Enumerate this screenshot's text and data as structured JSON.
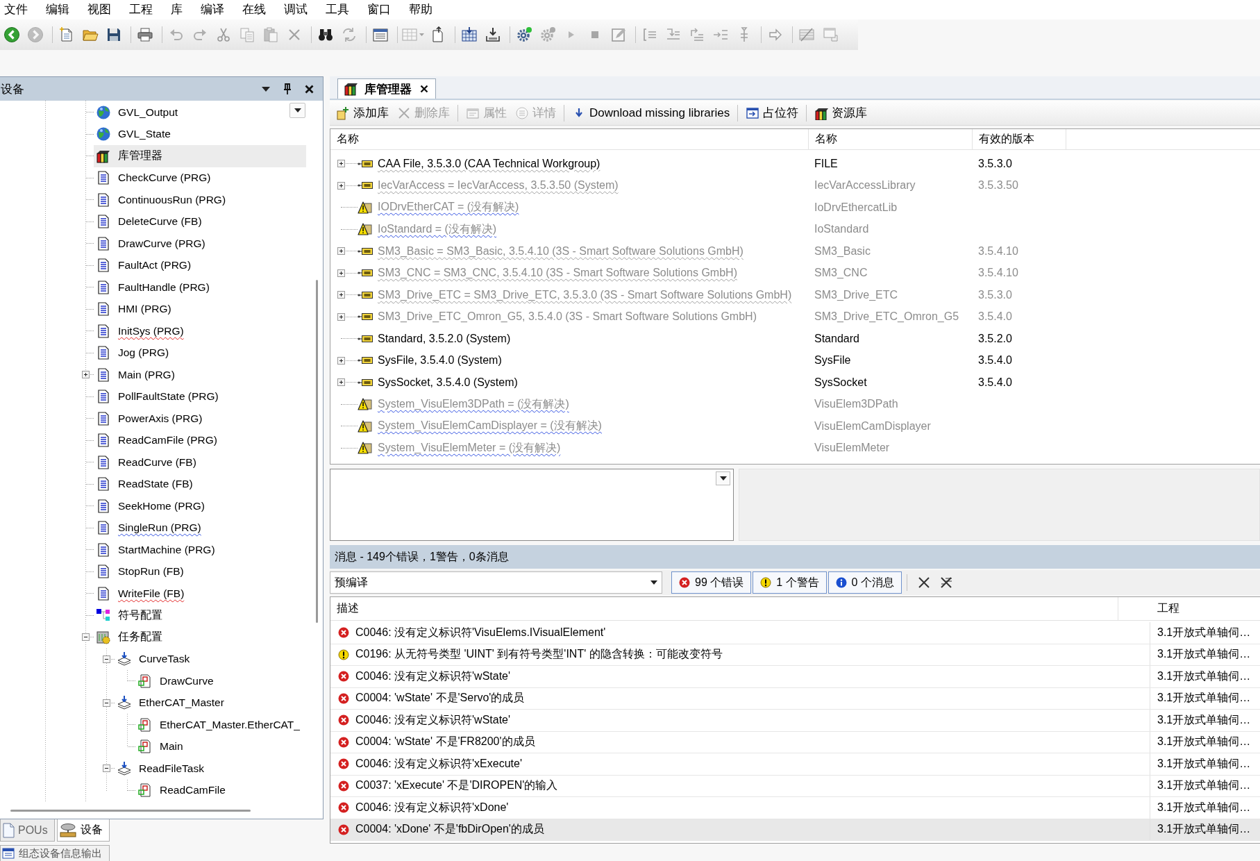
{
  "menu": [
    "文件",
    "编辑",
    "视图",
    "工程",
    "库",
    "编译",
    "在线",
    "调试",
    "工具",
    "窗口",
    "帮助"
  ],
  "toolbar": [
    [
      {
        "disabled": false
      },
      {
        "disabled": true
      }
    ],
    [
      {
        "disabled": false
      },
      {
        "disabled": false
      },
      {
        "disabled": false
      }
    ],
    [
      {
        "disabled": false
      }
    ],
    [
      {
        "disabled": true
      },
      {
        "disabled": true
      },
      {
        "disabled": true
      },
      {
        "disabled": true
      },
      {
        "disabled": true
      },
      {
        "disabled": true
      }
    ],
    [
      {
        "disabled": false
      },
      {
        "disabled": true
      }
    ],
    [
      {
        "disabled": false
      }
    ],
    [
      {
        "disabled": true
      },
      {
        "disabled": false
      }
    ],
    [
      {
        "disabled": false
      },
      {
        "disabled": false
      }
    ],
    [
      {
        "disabled": false
      },
      {
        "disabled": true
      },
      {
        "disabled": true
      },
      {
        "disabled": true
      },
      {
        "disabled": true
      }
    ],
    [
      {
        "disabled": true
      },
      {
        "disabled": true
      },
      {
        "disabled": true
      },
      {
        "disabled": true
      },
      {
        "disabled": true
      }
    ],
    [
      {
        "disabled": true
      }
    ],
    [
      {
        "disabled": true
      },
      {
        "disabled": true
      }
    ]
  ],
  "device_panel": {
    "title": "设备",
    "tree": [
      {
        "label": "GVL_Output",
        "kind": "gvl",
        "selected": false,
        "error": false,
        "warning": false
      },
      {
        "label": "GVL_State",
        "kind": "gvl",
        "selected": false,
        "error": false,
        "warning": false
      },
      {
        "label": "库管理器",
        "kind": "library_manager",
        "selected": true,
        "error": false,
        "warning": false
      },
      {
        "label": "CheckCurve (PRG)",
        "kind": "pou",
        "selected": false,
        "error": false,
        "warning": false
      },
      {
        "label": "ContinuousRun (PRG)",
        "kind": "pou",
        "selected": false,
        "error": false,
        "warning": false
      },
      {
        "label": "DeleteCurve (FB)",
        "kind": "pou",
        "selected": false,
        "error": false,
        "warning": false
      },
      {
        "label": "DrawCurve (PRG)",
        "kind": "pou",
        "selected": false,
        "error": false,
        "warning": false
      },
      {
        "label": "FaultAct (PRG)",
        "kind": "pou",
        "selected": false,
        "error": false,
        "warning": false
      },
      {
        "label": "FaultHandle (PRG)",
        "kind": "pou",
        "selected": false,
        "error": false,
        "warning": false
      },
      {
        "label": "HMI (PRG)",
        "kind": "pou",
        "selected": false,
        "error": false,
        "warning": false
      },
      {
        "label": "InitSys (PRG)",
        "kind": "pou",
        "selected": false,
        "error": true,
        "warning": false
      },
      {
        "label": "Jog (PRG)",
        "kind": "pou",
        "selected": false,
        "error": false,
        "warning": false
      },
      {
        "label": "Main (PRG)",
        "kind": "pou",
        "selected": false,
        "error": false,
        "warning": false,
        "expanded": false
      },
      {
        "label": "PollFaultState (PRG)",
        "kind": "pou",
        "selected": false,
        "error": false,
        "warning": false
      },
      {
        "label": "PowerAxis (PRG)",
        "kind": "pou",
        "selected": false,
        "error": false,
        "warning": false
      },
      {
        "label": "ReadCamFile (PRG)",
        "kind": "pou",
        "selected": false,
        "error": false,
        "warning": false
      },
      {
        "label": "ReadCurve (FB)",
        "kind": "pou",
        "selected": false,
        "error": false,
        "warning": false
      },
      {
        "label": "ReadState (FB)",
        "kind": "pou",
        "selected": false,
        "error": false,
        "warning": false
      },
      {
        "label": "SeekHome (PRG)",
        "kind": "pou",
        "selected": false,
        "error": false,
        "warning": false
      },
      {
        "label": "SingleRun (PRG)",
        "kind": "pou",
        "selected": false,
        "error": false,
        "warning": true
      },
      {
        "label": "StartMachine (PRG)",
        "kind": "pou",
        "selected": false,
        "error": false,
        "warning": false
      },
      {
        "label": "StopRun (FB)",
        "kind": "pou",
        "selected": false,
        "error": false,
        "warning": false
      },
      {
        "label": "WriteFile (FB)",
        "kind": "pou",
        "selected": false,
        "error": true,
        "warning": false
      },
      {
        "label": "符号配置",
        "kind": "symbol_config",
        "selected": false,
        "error": false,
        "warning": false
      },
      {
        "label": "任务配置",
        "kind": "task_config",
        "selected": false,
        "error": false,
        "warning": false,
        "expanded": true,
        "children": [
          {
            "label": "CurveTask",
            "kind": "task",
            "selected": false,
            "error": false,
            "warning": false,
            "expanded": true,
            "children": [
              {
                "label": "DrawCurve",
                "kind": "call",
                "selected": false,
                "error": false,
                "warning": false
              }
            ]
          },
          {
            "label": "EtherCAT_Master",
            "kind": "task",
            "selected": false,
            "error": false,
            "warning": false,
            "expanded": true,
            "children": [
              {
                "label": "EtherCAT_Master.EtherCAT_",
                "kind": "call",
                "selected": false,
                "error": false,
                "warning": false
              },
              {
                "label": "Main",
                "kind": "call",
                "selected": false,
                "error": false,
                "warning": false
              }
            ]
          },
          {
            "label": "ReadFileTask",
            "kind": "task",
            "selected": false,
            "error": false,
            "warning": false,
            "expanded": true,
            "children": [
              {
                "label": "ReadCamFile",
                "kind": "call",
                "selected": false,
                "error": false,
                "warning": false
              }
            ]
          }
        ]
      }
    ],
    "tabs": [
      {
        "label": "POUs",
        "selected": false
      },
      {
        "label": "设备",
        "selected": true
      }
    ]
  },
  "output_tab": {
    "label": "组态设备信息输出"
  },
  "editor_tabs": [
    {
      "label": "库管理器",
      "selected": true
    }
  ],
  "library_toolbar": [
    {
      "label": "添加库",
      "disabled": false
    },
    {
      "label": "删除库",
      "disabled": true
    },
    {
      "label": "属性",
      "disabled": true
    },
    {
      "label": "详情",
      "disabled": true
    },
    {
      "label": "Download missing libraries",
      "disabled": false
    },
    {
      "label": "占位符",
      "disabled": false
    },
    {
      "label": "资源库",
      "disabled": false
    }
  ],
  "library_table": {
    "columns": [
      "名称",
      "名称",
      "有效的版本"
    ],
    "rows": [
      {
        "kind": "library",
        "cells": [
          "CAA File, 3.5.3.0 (CAA Technical Workgroup)",
          "FILE",
          "3.5.3.0"
        ],
        "expanded": false,
        "dimmed": false,
        "hint": true,
        "warning": false
      },
      {
        "kind": "library",
        "cells": [
          "IecVarAccess = IecVarAccess, 3.5.3.50 (System)",
          "IecVarAccessLibrary",
          "3.5.3.50"
        ],
        "expanded": false,
        "dimmed": true,
        "hint": true,
        "warning": false
      },
      {
        "kind": "unresolved",
        "cells": [
          "IODrvEtherCAT = (没有解决)",
          "IoDrvEthercatLib"
        ],
        "dimmed": true,
        "hint": false,
        "warning": true
      },
      {
        "kind": "unresolved",
        "cells": [
          "IoStandard = (没有解决)",
          "IoStandard"
        ],
        "dimmed": true,
        "hint": false,
        "warning": true
      },
      {
        "kind": "library",
        "cells": [
          "SM3_Basic = SM3_Basic, 3.5.4.10 (3S - Smart Software Solutions GmbH)",
          "SM3_Basic",
          "3.5.4.10"
        ],
        "expanded": false,
        "dimmed": true,
        "hint": true,
        "warning": false
      },
      {
        "kind": "library",
        "cells": [
          "SM3_CNC = SM3_CNC, 3.5.4.10 (3S - Smart Software Solutions GmbH)",
          "SM3_CNC",
          "3.5.4.10"
        ],
        "expanded": false,
        "dimmed": true,
        "hint": true,
        "warning": false
      },
      {
        "kind": "library",
        "cells": [
          "SM3_Drive_ETC = SM3_Drive_ETC, 3.5.3.0 (3S - Smart Software Solutions GmbH)",
          "SM3_Drive_ETC",
          "3.5.3.0"
        ],
        "expanded": false,
        "dimmed": true,
        "hint": true,
        "warning": false
      },
      {
        "kind": "library",
        "cells": [
          "SM3_Drive_ETC_Omron_G5, 3.5.4.0 (3S - Smart Software Solutions GmbH)",
          "SM3_Drive_ETC_Omron_G5",
          "3.5.4.0"
        ],
        "expanded": false,
        "dimmed": true,
        "hint": false,
        "warning": false
      },
      {
        "kind": "library",
        "cells": [
          "Standard, 3.5.2.0 (System)",
          "Standard",
          "3.5.2.0"
        ],
        "dimmed": false,
        "hint": false,
        "warning": false
      },
      {
        "kind": "library",
        "cells": [
          "SysFile, 3.5.4.0 (System)",
          "SysFile",
          "3.5.4.0"
        ],
        "expanded": false,
        "dimmed": false,
        "hint": false,
        "warning": false
      },
      {
        "kind": "library",
        "cells": [
          "SysSocket, 3.5.4.0 (System)",
          "SysSocket",
          "3.5.4.0"
        ],
        "expanded": false,
        "dimmed": false,
        "hint": false,
        "warning": false
      },
      {
        "kind": "unresolved",
        "cells": [
          "System_VisuElem3DPath = (没有解决)",
          "VisuElem3DPath"
        ],
        "dimmed": true,
        "hint": false,
        "warning": true
      },
      {
        "kind": "unresolved",
        "cells": [
          "System_VisuElemCamDisplayer = (没有解决)",
          "VisuElemCamDisplayer"
        ],
        "dimmed": true,
        "hint": false,
        "warning": true
      },
      {
        "kind": "unresolved",
        "cells": [
          "System_VisuElemMeter = (没有解决)",
          "VisuElemMeter"
        ],
        "dimmed": true,
        "hint": false,
        "warning": true
      }
    ]
  },
  "messages": {
    "title": "消息 - 149个错误，1警告，0条消息",
    "category": "预编译",
    "filters": [
      {
        "kind": "error",
        "label": "99 个错误",
        "on": true
      },
      {
        "kind": "warning",
        "label": "1 个警告",
        "on": true
      },
      {
        "kind": "info",
        "label": "0 个消息",
        "on": true
      }
    ],
    "columns": [
      "描述",
      "工程"
    ],
    "rows": [
      {
        "kind": "error",
        "description": "C0046: 没有定义标识符'VisuElems.IVisualElement'",
        "project": "3.1开放式单轴伺…",
        "selected": false
      },
      {
        "kind": "warning",
        "description": "C0196: 从无符号类型 'UINT' 到有符号类型'INT' 的隐含转换：可能改变符号",
        "project": "3.1开放式单轴伺…",
        "selected": false
      },
      {
        "kind": "error",
        "description": "C0046: 没有定义标识符'wState'",
        "project": "3.1开放式单轴伺…",
        "selected": false
      },
      {
        "kind": "error",
        "description": "C0004: 'wState' 不是'Servo'的成员",
        "project": "3.1开放式单轴伺…",
        "selected": false
      },
      {
        "kind": "error",
        "description": "C0046: 没有定义标识符'wState'",
        "project": "3.1开放式单轴伺…",
        "selected": false
      },
      {
        "kind": "error",
        "description": "C0004: 'wState' 不是'FR8200'的成员",
        "project": "3.1开放式单轴伺…",
        "selected": false
      },
      {
        "kind": "error",
        "description": "C0046: 没有定义标识符'xExecute'",
        "project": "3.1开放式单轴伺…",
        "selected": false
      },
      {
        "kind": "error",
        "description": "C0037: 'xExecute' 不是'DIROPEN'的输入",
        "project": "3.1开放式单轴伺…",
        "selected": false
      },
      {
        "kind": "error",
        "description": "C0046: 没有定义标识符'xDone'",
        "project": "3.1开放式单轴伺…",
        "selected": false
      },
      {
        "kind": "error",
        "description": "C0004: 'xDone' 不是'fbDirOpen'的成员",
        "project": "3.1开放式单轴伺…",
        "selected": true
      }
    ]
  }
}
